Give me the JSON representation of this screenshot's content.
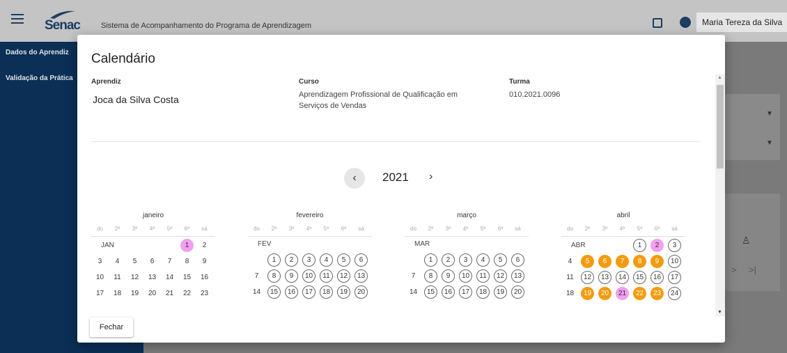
{
  "header": {
    "logo_text": "Senac",
    "app_title": "Sistema de Acompanhamento do Programa de Aprendizagem",
    "user_name": "Maria Tereza da Silva"
  },
  "sidebar": {
    "items": [
      {
        "label": "Dados do Aprendiz"
      },
      {
        "label": "Validação da Prática"
      }
    ]
  },
  "background": {
    "paginator_next": ">",
    "paginator_last": ">|"
  },
  "modal": {
    "title": "Calendário",
    "aprendiz_label": "Aprendiz",
    "aprendiz_value": "Joca da Silva Costa",
    "curso_label": "Curso",
    "curso_value_line1": "Aprendizagem Profissional de Qualificação em",
    "curso_value_line2": "Serviços de Vendas",
    "turma_label": "Turma",
    "turma_value": "010.2021.0096",
    "year": "2021",
    "prev_year_icon": "‹",
    "next_year_icon": "›",
    "close_label": "Fechar"
  },
  "calendar": {
    "weekdays": [
      "do",
      "2ª",
      "3ª",
      "4ª",
      "5ª",
      "6ª",
      "sá"
    ],
    "months": [
      {
        "name": "janeiro",
        "abbr": "JAN",
        "rows": [
          [
            null,
            null,
            null,
            null,
            null,
            {
              "d": "1",
              "s": "p"
            },
            {
              "d": "2",
              "s": ""
            }
          ],
          [
            {
              "d": "3",
              "s": ""
            },
            {
              "d": "4",
              "s": ""
            },
            {
              "d": "5",
              "s": ""
            },
            {
              "d": "6",
              "s": ""
            },
            {
              "d": "7",
              "s": ""
            },
            {
              "d": "8",
              "s": ""
            },
            {
              "d": "9",
              "s": ""
            }
          ],
          [
            {
              "d": "10",
              "s": ""
            },
            {
              "d": "11",
              "s": ""
            },
            {
              "d": "12",
              "s": ""
            },
            {
              "d": "13",
              "s": ""
            },
            {
              "d": "14",
              "s": ""
            },
            {
              "d": "15",
              "s": ""
            },
            {
              "d": "16",
              "s": ""
            }
          ],
          [
            {
              "d": "17",
              "s": ""
            },
            {
              "d": "18",
              "s": ""
            },
            {
              "d": "19",
              "s": ""
            },
            {
              "d": "20",
              "s": ""
            },
            {
              "d": "21",
              "s": ""
            },
            {
              "d": "22",
              "s": ""
            },
            {
              "d": "23",
              "s": ""
            }
          ]
        ]
      },
      {
        "name": "fevereiro",
        "abbr": "FEV",
        "rows": [
          [
            null,
            {
              "d": "1",
              "s": "o"
            },
            {
              "d": "2",
              "s": "o"
            },
            {
              "d": "3",
              "s": "o"
            },
            {
              "d": "4",
              "s": "o"
            },
            {
              "d": "5",
              "s": "o"
            },
            {
              "d": "6",
              "s": "o"
            }
          ],
          [
            {
              "d": "7",
              "s": ""
            },
            {
              "d": "8",
              "s": "o"
            },
            {
              "d": "9",
              "s": "o"
            },
            {
              "d": "10",
              "s": "o"
            },
            {
              "d": "11",
              "s": "o"
            },
            {
              "d": "12",
              "s": "o"
            },
            {
              "d": "13",
              "s": "o"
            }
          ],
          [
            {
              "d": "14",
              "s": ""
            },
            {
              "d": "15",
              "s": "o"
            },
            {
              "d": "16",
              "s": "o"
            },
            {
              "d": "17",
              "s": "o"
            },
            {
              "d": "18",
              "s": "o"
            },
            {
              "d": "19",
              "s": "o"
            },
            {
              "d": "20",
              "s": "o"
            }
          ]
        ]
      },
      {
        "name": "março",
        "abbr": "MAR",
        "rows": [
          [
            null,
            {
              "d": "1",
              "s": "o"
            },
            {
              "d": "2",
              "s": "o"
            },
            {
              "d": "3",
              "s": "o"
            },
            {
              "d": "4",
              "s": "o"
            },
            {
              "d": "5",
              "s": "o"
            },
            {
              "d": "6",
              "s": "o"
            }
          ],
          [
            {
              "d": "7",
              "s": ""
            },
            {
              "d": "8",
              "s": "o"
            },
            {
              "d": "9",
              "s": "o"
            },
            {
              "d": "10",
              "s": "o"
            },
            {
              "d": "11",
              "s": "o"
            },
            {
              "d": "12",
              "s": "o"
            },
            {
              "d": "13",
              "s": "o"
            }
          ],
          [
            {
              "d": "14",
              "s": ""
            },
            {
              "d": "15",
              "s": "o"
            },
            {
              "d": "16",
              "s": "o"
            },
            {
              "d": "17",
              "s": "o"
            },
            {
              "d": "18",
              "s": "o"
            },
            {
              "d": "19",
              "s": "o"
            },
            {
              "d": "20",
              "s": "o"
            }
          ]
        ]
      },
      {
        "name": "abril",
        "abbr": "ABR",
        "rows": [
          [
            null,
            null,
            null,
            null,
            {
              "d": "1",
              "s": "o"
            },
            {
              "d": "2",
              "s": "p"
            },
            {
              "d": "3",
              "s": "o"
            }
          ],
          [
            {
              "d": "4",
              "s": ""
            },
            {
              "d": "5",
              "s": "g"
            },
            {
              "d": "6",
              "s": "g"
            },
            {
              "d": "7",
              "s": "g"
            },
            {
              "d": "8",
              "s": "g"
            },
            {
              "d": "9",
              "s": "g"
            },
            {
              "d": "10",
              "s": "o"
            }
          ],
          [
            {
              "d": "11",
              "s": ""
            },
            {
              "d": "12",
              "s": "o"
            },
            {
              "d": "13",
              "s": "o"
            },
            {
              "d": "14",
              "s": "o"
            },
            {
              "d": "15",
              "s": "o"
            },
            {
              "d": "16",
              "s": "o"
            },
            {
              "d": "17",
              "s": "o"
            }
          ],
          [
            {
              "d": "18",
              "s": ""
            },
            {
              "d": "19",
              "s": "g"
            },
            {
              "d": "20",
              "s": "g"
            },
            {
              "d": "21",
              "s": "p"
            },
            {
              "d": "22",
              "s": "g"
            },
            {
              "d": "23",
              "s": "g"
            },
            {
              "d": "24",
              "s": "o"
            }
          ]
        ]
      }
    ]
  },
  "colors": {
    "navy": "#0b2f55",
    "holiday_pink": "#f0a0ef",
    "activity_orange": "#f39b0f"
  }
}
